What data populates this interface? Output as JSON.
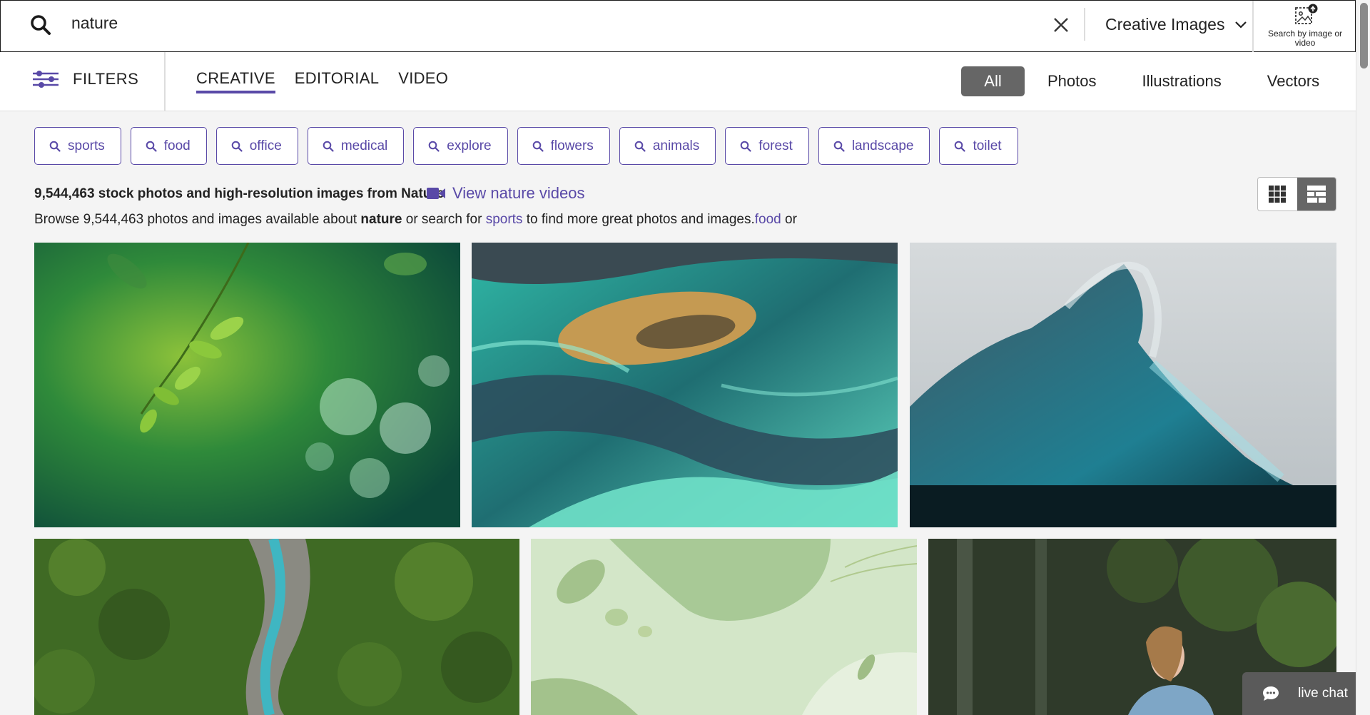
{
  "search": {
    "query": "nature",
    "asset_type": "Creative Images",
    "search_by_image_label": "Search by image or video"
  },
  "nav": {
    "filters_label": "FILTERS",
    "media_tabs": [
      {
        "label": "CREATIVE",
        "active": true
      },
      {
        "label": "EDITORIAL",
        "active": false
      },
      {
        "label": "VIDEO",
        "active": false
      }
    ],
    "type_tabs": [
      {
        "label": "All",
        "active": true
      },
      {
        "label": "Photos",
        "active": false
      },
      {
        "label": "Illustrations",
        "active": false
      },
      {
        "label": "Vectors",
        "active": false
      }
    ]
  },
  "related_searches": [
    "sports",
    "food",
    "office",
    "medical",
    "explore",
    "flowers",
    "animals",
    "forest",
    "landscape",
    "toilet"
  ],
  "results": {
    "count_heading": "9,544,463 stock photos and high-resolution images from Nature",
    "video_link": "View nature videos",
    "browse_pre": "Browse 9,544,463 photos and images available about",
    "browse_term": "nature",
    "browse_mid": "or search for",
    "browse_link1": "sports",
    "browse_post": "to find more great photos and images.",
    "browse_link2": "food",
    "browse_end": "or"
  },
  "images": [
    {
      "subject": "green leaves bokeh"
    },
    {
      "subject": "aerial glacial river"
    },
    {
      "subject": "ocean wave"
    },
    {
      "subject": "aerial forest river"
    },
    {
      "subject": "green botanical illustration"
    },
    {
      "subject": "woman in forest"
    }
  ],
  "colors": {
    "accent": "#5949a7",
    "pill_bg": "#666666",
    "chat_bg": "#5a5a5a"
  },
  "live_chat_label": "live chat"
}
